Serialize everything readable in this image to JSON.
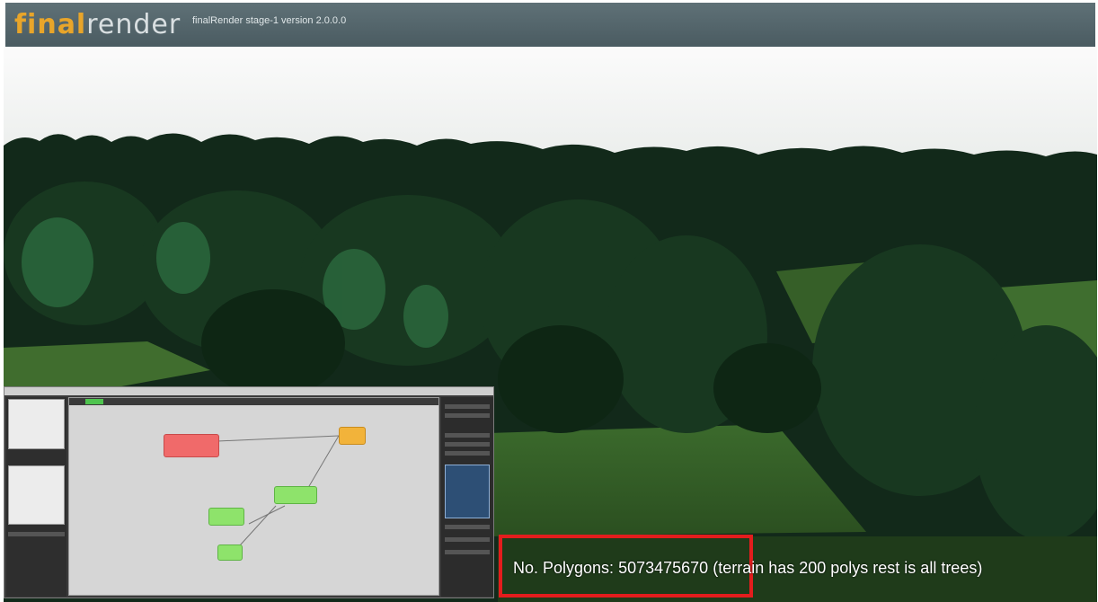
{
  "header": {
    "logo_part1": "final",
    "logo_part2": "render",
    "version": "finalRender stage-1 version 2.0.0.0"
  },
  "status": {
    "label": "No. Polygons:",
    "count": "5073475670",
    "note": "(terrain has 200 polys rest is all trees)"
  },
  "colors": {
    "header_bg": "#56676d",
    "logo_accent": "#e8a52a",
    "highlight_border": "#e31d1d",
    "node_red": "#f06a6a",
    "node_orange": "#f2b33a",
    "node_green": "#8ee36b"
  }
}
